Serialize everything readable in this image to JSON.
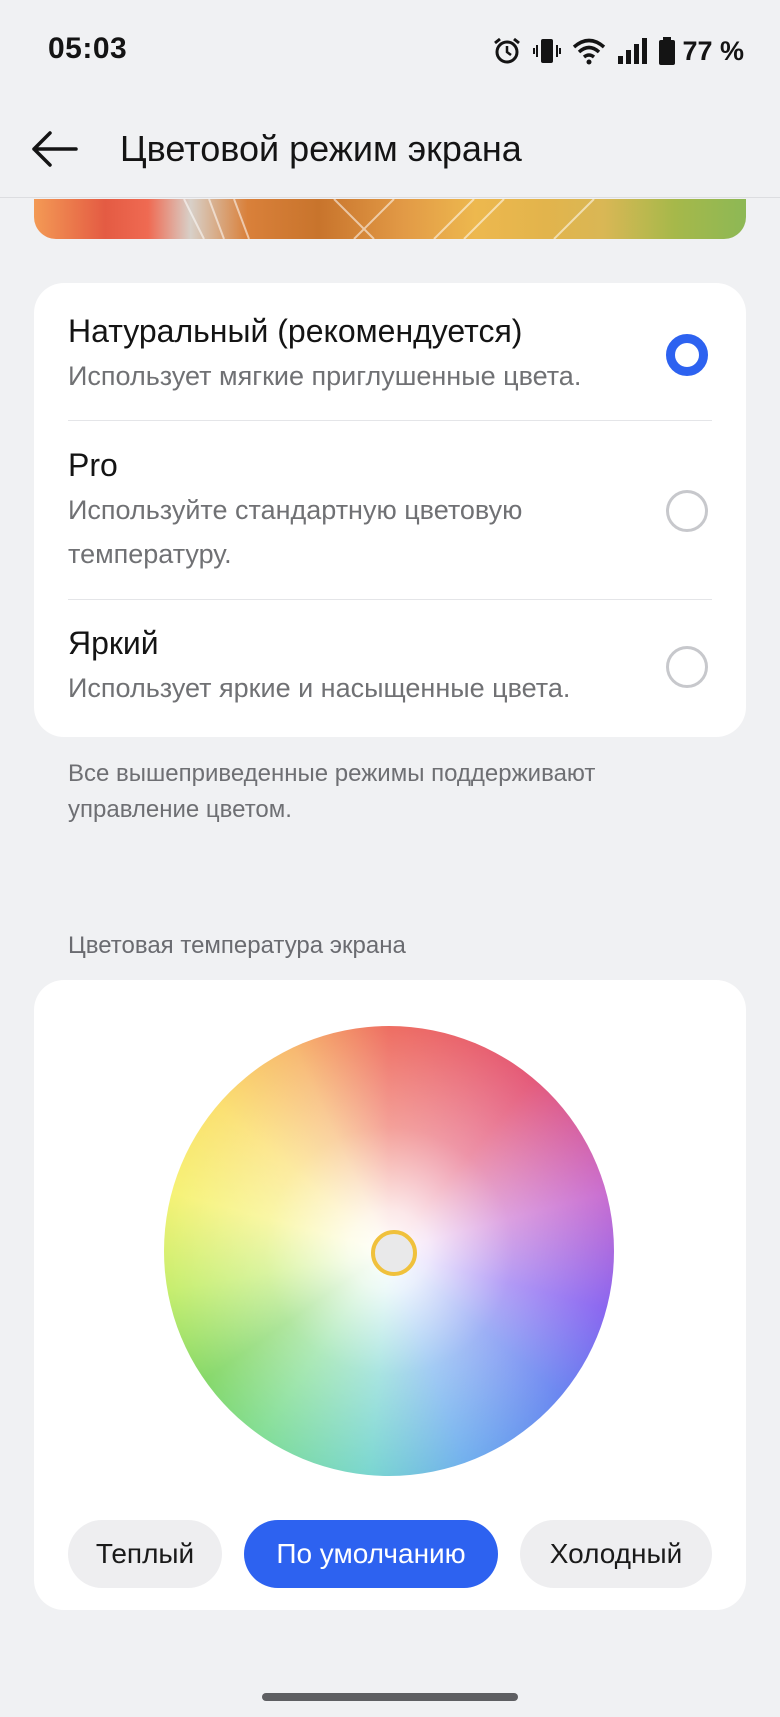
{
  "status_bar": {
    "time": "05:03",
    "battery": "77 %",
    "icons": [
      "alarm-icon",
      "vibrate-icon",
      "wifi-icon",
      "signal-icon",
      "battery-icon"
    ]
  },
  "header": {
    "title": "Цветовой режим экрана",
    "back_icon": "back-arrow-icon"
  },
  "modes": [
    {
      "title": "Натуральный (рекомендуется)",
      "desc": "Использует мягкие приглушенные цвета.",
      "selected": true
    },
    {
      "title": "Pro",
      "desc": "Используйте стандартную цветовую температуру.",
      "selected": false
    },
    {
      "title": "Яркий",
      "desc": "Использует яркие и насыщенные цвета.",
      "selected": false
    }
  ],
  "footnote": "Все вышеприведенные режимы поддерживают управление цветом.",
  "color_temperature": {
    "label": "Цветовая температура экрана",
    "presets": [
      "Теплый",
      "По умолчанию",
      "Холодный"
    ],
    "selected_preset": "По умолчанию"
  },
  "colors": {
    "accent": "#2d62f0",
    "background": "#f0f1f3",
    "card": "#ffffff",
    "knob_ring": "#f0c13c"
  }
}
